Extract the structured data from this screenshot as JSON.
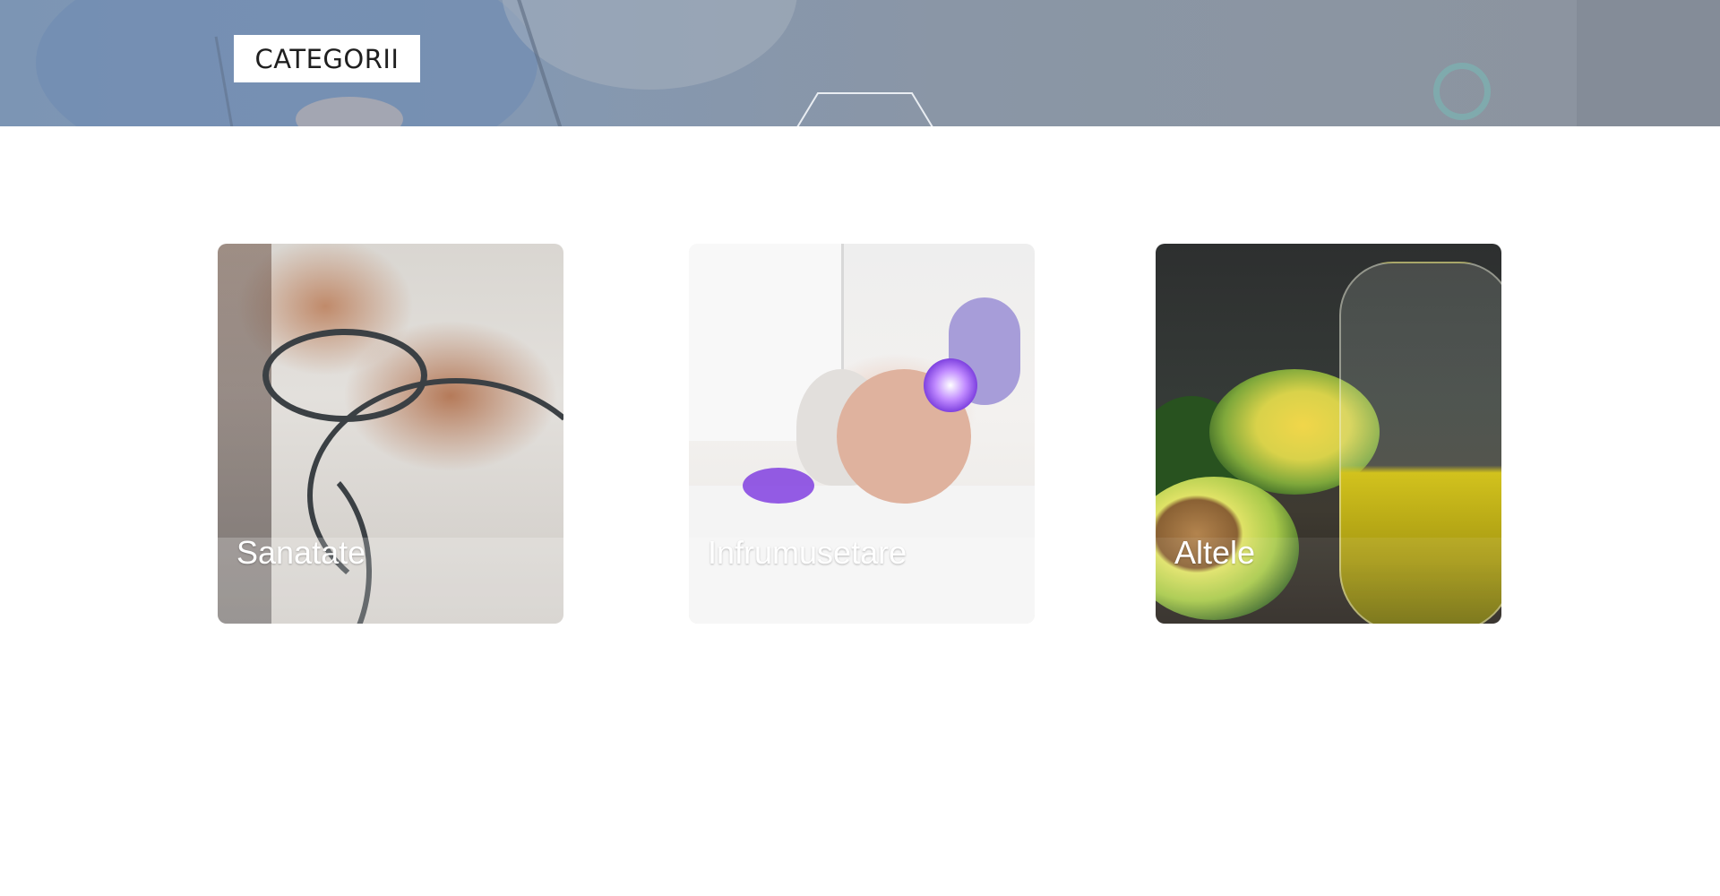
{
  "header": {
    "badge_label": "CATEGORII"
  },
  "categories": [
    {
      "label": "Sanatate",
      "image": "doctor-hands-stethoscope-photo"
    },
    {
      "label": "Infrumusetare",
      "image": "facial-light-treatment-photo"
    },
    {
      "label": "Altele",
      "image": "avocado-oil-jar-photo"
    }
  ],
  "colors": {
    "hero_overlay": "#8496ad",
    "label_text": "#ffffff",
    "badge_background": "#ffffff",
    "badge_text": "#1f1f1f"
  }
}
